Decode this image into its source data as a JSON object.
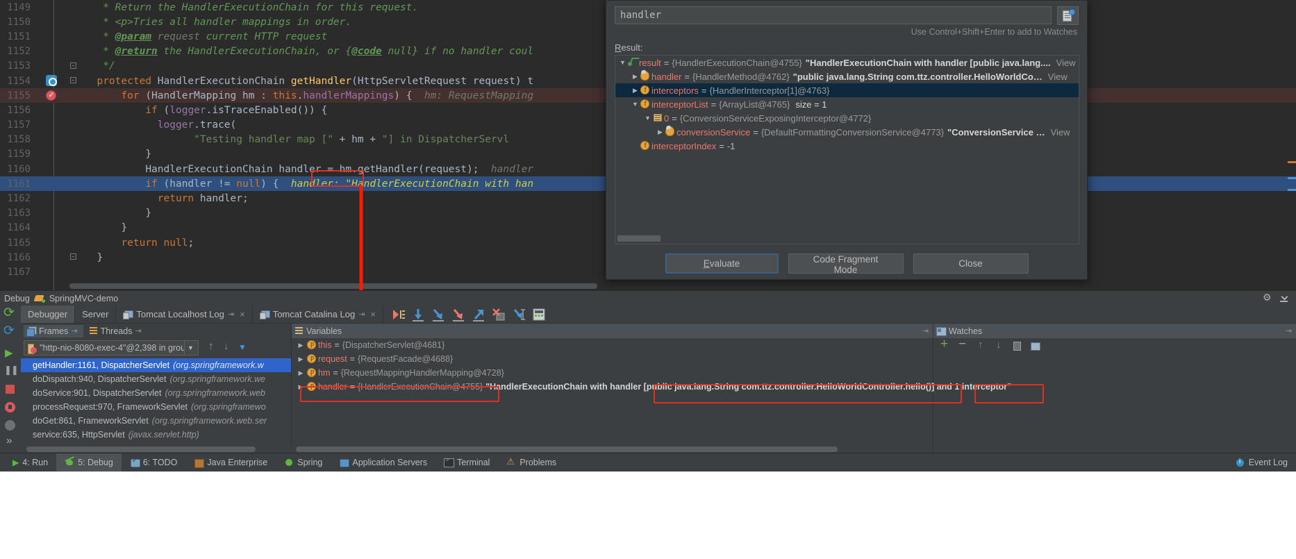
{
  "editor": {
    "lines": [
      {
        "num": "1149",
        "text": " * Return the HandlerExecutionChain for this request."
      },
      {
        "num": "1150",
        "text": " * <p>Tries all handler mappings in order."
      },
      {
        "num": "1151",
        "text": " * @param request current HTTP request"
      },
      {
        "num": "1152",
        "text": " * @return the HandlerExecutionChain, or {@code null} if no handler coul"
      },
      {
        "num": "1153",
        "text": " */"
      },
      {
        "num": "1154",
        "text": "protected HandlerExecutionChain getHandler(HttpServletRequest request) t"
      },
      {
        "num": "1155",
        "text": "for (HandlerMapping hm : this.handlerMappings) {  hm: RequestMapping"
      },
      {
        "num": "1156",
        "text": "if (logger.isTraceEnabled()) {"
      },
      {
        "num": "1157",
        "text": "logger.trace("
      },
      {
        "num": "1158",
        "text": "\"Testing handler map [\" + hm + \"] in DispatcherServl"
      },
      {
        "num": "1159",
        "text": "}"
      },
      {
        "num": "1160",
        "text": "HandlerExecutionChain handler = hm.getHandler(request);  handler"
      },
      {
        "num": "1161",
        "text": "if (handler != null) {  handler: \"HandlerExecutionChain with han"
      },
      {
        "num": "1162",
        "text": "return handler;"
      },
      {
        "num": "1163",
        "text": "}"
      },
      {
        "num": "1164",
        "text": "}"
      },
      {
        "num": "1165",
        "text": "return null;"
      },
      {
        "num": "1166",
        "text": "}"
      },
      {
        "num": "1167",
        "text": ""
      }
    ],
    "tokens": {
      "kw_protected": "protected",
      "kw_for": "for",
      "kw_if": "if",
      "kw_return": "return",
      "kw_null": "null",
      "cls_hec": "HandlerExecutionChain",
      "mth_getHandler": "getHandler",
      "var_handler": "handler",
      "hint_hm": "hm: RequestMapping",
      "hint_handler_label": "handler:",
      "hint_handler_value": "\"HandlerExecutionChain with han"
    }
  },
  "evaluate_dialog": {
    "expression": "handler",
    "hint": "Use Control+Shift+Enter to add to Watches",
    "result_label": "Result:",
    "history_button": "evaluate-history",
    "tree": [
      {
        "indent": 0,
        "twisty": "▼",
        "icon": "result-icon",
        "name": "result",
        "eq": "=",
        "ref": "{HandlerExecutionChain@4755}",
        "value": "\"HandlerExecutionChain with handler [public java.lang....",
        "view": "View",
        "selected": false
      },
      {
        "indent": 1,
        "twisty": "▶",
        "icon": "cap-field-icon",
        "name": "handler",
        "eq": "=",
        "ref": "{HandlerMethod@4762}",
        "value": "\"public java.lang.String com.ttz.controller.HelloWorldCo…",
        "view": "View",
        "selected": false
      },
      {
        "indent": 1,
        "twisty": "▶",
        "icon": "field-icon",
        "name": "interceptors",
        "eq": "=",
        "ref": "{HandlerInterceptor[1]@4763}",
        "value": "",
        "view": "",
        "selected": true
      },
      {
        "indent": 1,
        "twisty": "▼",
        "icon": "field-icon",
        "name": "interceptorList",
        "eq": "=",
        "ref": "{ArrayList@4765}",
        "value": "size = 1",
        "view": "",
        "selected": false
      },
      {
        "indent": 2,
        "twisty": "▼",
        "icon": "list-icon",
        "name": "0",
        "eq": "=",
        "ref": "{ConversionServiceExposingInterceptor@4772}",
        "value": "",
        "view": "",
        "selected": false
      },
      {
        "indent": 3,
        "twisty": "▶",
        "icon": "cap-field-icon",
        "name": "conversionService",
        "eq": "=",
        "ref": "{DefaultFormattingConversionService@4773}",
        "value": "\"ConversionService …",
        "view": "View",
        "selected": false
      },
      {
        "indent": 1,
        "twisty": "",
        "icon": "field-icon",
        "name": "interceptorIndex",
        "eq": "=",
        "ref": "-1",
        "value": "",
        "view": "",
        "selected": false
      }
    ],
    "buttons": {
      "evaluate": "Evaluate",
      "evaluate_mnemonic": "E",
      "code_fragment_mode": "Code Fragment Mode",
      "close": "Close"
    }
  },
  "debug_panel": {
    "title": "Debug",
    "config_name": "SpringMVC-demo",
    "tabs": [
      {
        "label": "Debugger",
        "icon": "",
        "active": true,
        "closable": false
      },
      {
        "label": "Server",
        "icon": "",
        "active": false,
        "closable": false
      },
      {
        "label": "Tomcat Localhost Log",
        "icon": "console-icon",
        "active": false,
        "closable": true
      },
      {
        "label": "Tomcat Catalina Log",
        "icon": "console-icon",
        "active": false,
        "closable": true
      }
    ],
    "left_toolbar": [
      "rerun-icon",
      "restart-icon",
      "resume-icon",
      "pause-icon",
      "stop-icon",
      "breakpoints-icon",
      "mute-breakpoints-icon",
      "more-icon"
    ],
    "step_toolbar": [
      "show-execution-point-icon",
      "step-over-icon",
      "step-into-icon",
      "force-step-into-icon",
      "step-out-icon",
      "drop-frame-icon",
      "run-to-cursor-icon",
      "evaluate-expression-icon"
    ],
    "frames_pane": {
      "tabs": [
        {
          "label": "Frames",
          "active": true
        },
        {
          "label": "Threads",
          "active": false
        }
      ],
      "thread_selector": "\"http-nio-8080-exec-4\"@2,398 in grou...",
      "frames": [
        {
          "method": "getHandler:1161, DispatcherServlet",
          "pkg": "(org.springframework.w",
          "selected": true
        },
        {
          "method": "doDispatch:940, DispatcherServlet",
          "pkg": "(org.springframework.we",
          "selected": false
        },
        {
          "method": "doService:901, DispatcherServlet",
          "pkg": "(org.springframework.web",
          "selected": false
        },
        {
          "method": "processRequest:970, FrameworkServlet",
          "pkg": "(org.springframewo",
          "selected": false
        },
        {
          "method": "doGet:861, FrameworkServlet",
          "pkg": "(org.springframework.web.ser",
          "selected": false
        },
        {
          "method": "service:635, HttpServlet",
          "pkg": "(javax.servlet.http)",
          "selected": false
        }
      ]
    },
    "variables_pane": {
      "title": "Variables",
      "rows": [
        {
          "twisty": "▶",
          "name": "this",
          "eq": "=",
          "ref": "{DispatcherServlet@4681}",
          "value": ""
        },
        {
          "twisty": "▶",
          "name": "request",
          "eq": "=",
          "ref": "{RequestFacade@4688}",
          "value": ""
        },
        {
          "twisty": "▶",
          "name": "hm",
          "eq": "=",
          "ref": "{RequestMappingHandlerMapping@4728}",
          "value": ""
        },
        {
          "twisty": "▶",
          "name": "handler",
          "eq": "=",
          "ref": "{HandlerExecutionChain@4755}",
          "value": "\"HandlerExecutionChain with handler [public java.lang.String com.ttz.controller.HelloWorldController.hello()] and 1 interceptor\""
        }
      ]
    },
    "watches_pane": {
      "title": "Watches",
      "toolbar": [
        "add-icon",
        "remove-icon",
        "move-up-icon",
        "move-down-icon",
        "copy-icon",
        "edit-icon"
      ]
    }
  },
  "statusbar": {
    "items": [
      {
        "label": "4: Run",
        "mnemonic": "4",
        "icon": "run-icon",
        "active": false
      },
      {
        "label": "5: Debug",
        "mnemonic": "5",
        "icon": "debug-icon",
        "active": true
      },
      {
        "label": "6: TODO",
        "mnemonic": "6",
        "icon": "todo-icon",
        "active": false
      },
      {
        "label": "Java Enterprise",
        "mnemonic": "",
        "icon": "java-icon",
        "active": false
      },
      {
        "label": "Spring",
        "mnemonic": "",
        "icon": "spring-icon",
        "active": false
      },
      {
        "label": "Application Servers",
        "mnemonic": "",
        "icon": "appserver-icon",
        "active": false
      },
      {
        "label": "Terminal",
        "mnemonic": "",
        "icon": "terminal-icon",
        "active": false
      },
      {
        "label": "Problems",
        "mnemonic": "",
        "icon": "problems-icon",
        "active": false
      }
    ],
    "event_log": "Event Log"
  },
  "annotations": {
    "highlight_boxes": [
      {
        "name": "handler-variable-box"
      },
      {
        "name": "handler-value-method-box"
      },
      {
        "name": "handler-value-interceptor-box"
      },
      {
        "name": "variables-handler-ref-box"
      }
    ],
    "arrow": "red-arrow-from-code-to-variables"
  }
}
